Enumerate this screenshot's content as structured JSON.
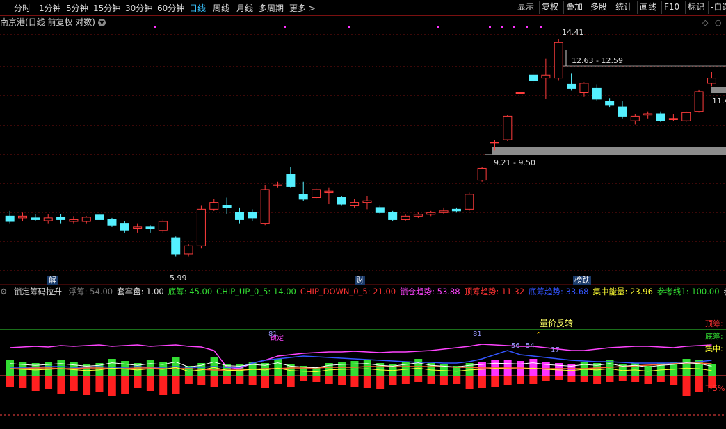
{
  "toolbar": {
    "periods": [
      "分时",
      "1分钟",
      "5分钟",
      "15分钟",
      "30分钟",
      "60分钟",
      "日线",
      "周线",
      "月线",
      "多周期",
      "更多 >"
    ],
    "active_period": "日线",
    "right_buttons": [
      "显示",
      "复权",
      "叠加",
      "多股",
      "统计",
      "画线",
      "F10",
      "标记",
      "-自选"
    ]
  },
  "title": "南京港(日线 前复权 对数)",
  "price_labels": {
    "high": "14.41",
    "low": "5.99",
    "zone_upper": "12.63 - 12.59",
    "zone_lower": "9.21 - 9.50",
    "right_edge": "11.4"
  },
  "event_tags": [
    "解",
    "财",
    "榜跌"
  ],
  "indicator": {
    "name": "锁定筹码拉升",
    "items": [
      {
        "label": "浮筹: 54.00",
        "color": "#7a7a7a"
      },
      {
        "label": "套牢盘: 1.00",
        "color": "#e0e0e0"
      },
      {
        "label": "底筹: 45.00",
        "color": "#33dd33"
      },
      {
        "label": "CHIP_UP_0_5: 14.00",
        "color": "#33dd33"
      },
      {
        "label": "CHIP_DOWN_0_5: 21.00",
        "color": "#ff3333"
      },
      {
        "label": "锁仓趋势: 53.88",
        "color": "#ff44ff"
      },
      {
        "label": "顶筹趋势: 11.32",
        "color": "#ff3333"
      },
      {
        "label": "底筹趋势: 33.68",
        "color": "#3355ff"
      },
      {
        "label": "集中能量: 23.96",
        "color": "#ffff33"
      },
      {
        "label": "参考线1: 100.00",
        "color": "#33dd33"
      },
      {
        "label": "参考线",
        "color": "#e0e0e0"
      }
    ],
    "signal_label": "量价反转",
    "lock_label": "锁定",
    "markers": [
      "81",
      "81",
      "56",
      "54",
      "17"
    ],
    "right_labels": [
      {
        "text": "顶筹:",
        "color": "#ff3333"
      },
      {
        "text": "底筹:",
        "color": "#33dd33"
      },
      {
        "text": "集中:",
        "color": "#ffff33"
      },
      {
        "text": "下5%",
        "color": "#ff3333"
      }
    ]
  },
  "colors": {
    "up": "#ff3c3c",
    "down": "#54f0ff",
    "grid": "#7a1010",
    "zone": "#8c8c8c"
  },
  "chart_data": {
    "type": "candlestick",
    "scale": "log",
    "ylim": [
      5.5,
      15.5
    ],
    "candles": [
      {
        "o": 7.05,
        "h": 7.2,
        "l": 6.85,
        "c": 6.9
      },
      {
        "o": 7.0,
        "h": 7.15,
        "l": 6.9,
        "c": 7.05
      },
      {
        "o": 7.0,
        "h": 7.1,
        "l": 6.9,
        "c": 6.95
      },
      {
        "o": 6.92,
        "h": 7.1,
        "l": 6.85,
        "c": 7.0
      },
      {
        "o": 7.02,
        "h": 7.1,
        "l": 6.85,
        "c": 6.95
      },
      {
        "o": 6.9,
        "h": 7.05,
        "l": 6.85,
        "c": 6.95
      },
      {
        "o": 6.9,
        "h": 7.05,
        "l": 6.85,
        "c": 7.02
      },
      {
        "o": 7.08,
        "h": 7.12,
        "l": 6.95,
        "c": 6.95
      },
      {
        "o": 6.95,
        "h": 7.0,
        "l": 6.75,
        "c": 6.8
      },
      {
        "o": 6.85,
        "h": 6.9,
        "l": 6.6,
        "c": 6.65
      },
      {
        "o": 6.7,
        "h": 6.85,
        "l": 6.6,
        "c": 6.75
      },
      {
        "o": 6.75,
        "h": 6.8,
        "l": 6.6,
        "c": 6.7
      },
      {
        "o": 6.65,
        "h": 6.95,
        "l": 6.6,
        "c": 6.9
      },
      {
        "o": 6.45,
        "h": 6.5,
        "l": 5.99,
        "c": 6.05
      },
      {
        "o": 6.05,
        "h": 6.3,
        "l": 5.99,
        "c": 6.25
      },
      {
        "o": 6.25,
        "h": 7.35,
        "l": 6.2,
        "c": 7.25
      },
      {
        "o": 7.25,
        "h": 7.55,
        "l": 7.2,
        "c": 7.45
      },
      {
        "o": 7.35,
        "h": 7.6,
        "l": 7.1,
        "c": 7.3
      },
      {
        "o": 7.15,
        "h": 7.3,
        "l": 6.85,
        "c": 6.95
      },
      {
        "o": 7.15,
        "h": 7.25,
        "l": 6.9,
        "c": 7.0
      },
      {
        "o": 6.85,
        "h": 8.0,
        "l": 6.8,
        "c": 7.85
      },
      {
        "o": 8.0,
        "h": 8.1,
        "l": 7.9,
        "c": 8.0
      },
      {
        "o": 8.35,
        "h": 8.6,
        "l": 7.9,
        "c": 7.95
      },
      {
        "o": 7.7,
        "h": 8.1,
        "l": 7.5,
        "c": 7.55
      },
      {
        "o": 7.6,
        "h": 7.9,
        "l": 7.55,
        "c": 7.85
      },
      {
        "o": 7.75,
        "h": 7.9,
        "l": 7.4,
        "c": 7.8
      },
      {
        "o": 7.6,
        "h": 7.65,
        "l": 7.35,
        "c": 7.4
      },
      {
        "o": 7.35,
        "h": 7.55,
        "l": 7.3,
        "c": 7.45
      },
      {
        "o": 7.45,
        "h": 7.65,
        "l": 7.25,
        "c": 7.5
      },
      {
        "o": 7.3,
        "h": 7.35,
        "l": 7.1,
        "c": 7.15
      },
      {
        "o": 7.15,
        "h": 7.2,
        "l": 6.9,
        "c": 6.95
      },
      {
        "o": 6.95,
        "h": 7.1,
        "l": 6.9,
        "c": 7.05
      },
      {
        "o": 7.05,
        "h": 7.15,
        "l": 7.0,
        "c": 7.1
      },
      {
        "o": 7.1,
        "h": 7.2,
        "l": 7.05,
        "c": 7.15
      },
      {
        "o": 7.15,
        "h": 7.3,
        "l": 7.1,
        "c": 7.2
      },
      {
        "o": 7.25,
        "h": 7.3,
        "l": 7.15,
        "c": 7.2
      },
      {
        "o": 7.25,
        "h": 7.75,
        "l": 7.2,
        "c": 7.7
      },
      {
        "o": 8.15,
        "h": 8.6,
        "l": 8.1,
        "c": 8.55
      },
      {
        "o": 9.5,
        "h": 9.6,
        "l": 9.2,
        "c": 9.5
      },
      {
        "o": 9.6,
        "h": 10.6,
        "l": 9.55,
        "c": 10.55
      },
      {
        "o": 11.6,
        "h": 11.6,
        "l": 11.6,
        "c": 11.6
      },
      {
        "o": 12.45,
        "h": 12.8,
        "l": 12.0,
        "c": 12.2
      },
      {
        "o": 12.3,
        "h": 13.3,
        "l": 11.3,
        "c": 12.45
      },
      {
        "o": 12.3,
        "h": 14.41,
        "l": 12.2,
        "c": 14.2
      },
      {
        "o": 12.0,
        "h": 12.55,
        "l": 11.7,
        "c": 11.8
      },
      {
        "o": 11.6,
        "h": 12.1,
        "l": 11.4,
        "c": 12.05
      },
      {
        "o": 11.8,
        "h": 12.0,
        "l": 11.2,
        "c": 11.3
      },
      {
        "o": 11.2,
        "h": 11.35,
        "l": 10.95,
        "c": 11.05
      },
      {
        "o": 10.95,
        "h": 11.2,
        "l": 10.45,
        "c": 10.55
      },
      {
        "o": 10.35,
        "h": 10.65,
        "l": 10.2,
        "c": 10.55
      },
      {
        "o": 10.6,
        "h": 10.75,
        "l": 10.45,
        "c": 10.65
      },
      {
        "o": 10.65,
        "h": 10.75,
        "l": 10.3,
        "c": 10.35
      },
      {
        "o": 10.4,
        "h": 10.65,
        "l": 10.35,
        "c": 10.45
      },
      {
        "o": 10.35,
        "h": 10.75,
        "l": 10.3,
        "c": 10.7
      },
      {
        "o": 10.75,
        "h": 11.75,
        "l": 10.7,
        "c": 11.65
      },
      {
        "o": 12.05,
        "h": 12.6,
        "l": 11.9,
        "c": 12.3
      }
    ],
    "bars": [
      22,
      20,
      18,
      20,
      22,
      19,
      16,
      18,
      24,
      21,
      18,
      22,
      20,
      26,
      14,
      18,
      26,
      17,
      16,
      20,
      18,
      24,
      16,
      14,
      12,
      18,
      20,
      21,
      22,
      18,
      16,
      20,
      24,
      18,
      16,
      14,
      18,
      20,
      23,
      22,
      21,
      24,
      20,
      18,
      16,
      20,
      18,
      22,
      16,
      18,
      14,
      18,
      20,
      24,
      22,
      16
    ],
    "bar_colors": [
      "g",
      "g",
      "g",
      "g",
      "g",
      "g",
      "g",
      "g",
      "g",
      "g",
      "g",
      "g",
      "g",
      "g",
      "g",
      "g",
      "g",
      "g",
      "g",
      "g",
      "g",
      "g",
      "g",
      "g",
      "g",
      "g",
      "g",
      "g",
      "g",
      "g",
      "g",
      "g",
      "g",
      "g",
      "g",
      "g",
      "g",
      "m",
      "m",
      "m",
      "m",
      "m",
      "m",
      "m",
      "m",
      "g",
      "g",
      "g",
      "g",
      "g",
      "g",
      "g",
      "g",
      "g",
      "g",
      "g"
    ],
    "neg_bars": [
      16,
      18,
      22,
      20,
      26,
      22,
      28,
      24,
      30,
      26,
      18,
      22,
      28,
      26,
      12,
      14,
      16,
      12,
      12,
      14,
      18,
      12,
      16,
      8,
      10,
      12,
      14,
      16,
      18,
      20,
      14,
      12,
      10,
      12,
      14,
      12,
      20,
      18,
      16,
      14,
      12,
      12,
      8,
      6,
      10,
      10,
      12,
      10,
      8,
      10,
      12,
      10,
      14,
      30,
      24,
      18
    ],
    "series": [
      {
        "name": "锁仓趋势",
        "values": [
          40,
          41,
          42,
          41,
          43,
          42,
          43,
          44,
          42,
          43,
          44,
          42,
          43,
          44,
          42,
          41,
          36,
          12,
          10,
          18,
          22,
          28,
          30,
          32,
          33,
          34,
          34,
          35,
          34,
          33,
          34,
          34,
          35,
          36,
          38,
          40,
          42,
          45,
          44,
          43,
          42,
          42,
          40,
          38,
          36,
          36,
          38,
          40,
          41,
          42,
          42,
          41,
          40,
          42,
          43,
          44
        ]
      },
      {
        "name": "底筹趋势",
        "values": [
          12,
          12,
          12,
          13,
          13,
          12,
          12,
          13,
          12,
          12,
          13,
          12,
          12,
          13,
          12,
          12,
          13,
          12,
          12,
          18,
          22,
          24,
          26,
          28,
          27,
          26,
          25,
          24,
          23,
          22,
          21,
          20,
          19,
          19,
          18,
          18,
          20,
          24,
          30,
          36,
          30,
          28,
          26,
          24,
          22,
          21,
          20,
          20,
          19,
          18,
          18,
          18,
          18,
          18,
          20,
          22
        ]
      },
      {
        "name": "顶筹趋势",
        "values": [
          10,
          10,
          11,
          11,
          10,
          10,
          11,
          11,
          10,
          10,
          11,
          11,
          10,
          10,
          10,
          9,
          8,
          8,
          8,
          9,
          10,
          10,
          11,
          11,
          11,
          12,
          12,
          12,
          13,
          13,
          13,
          13,
          13,
          13,
          13,
          12,
          12,
          11,
          11,
          11,
          11,
          10,
          10,
          10,
          10,
          10,
          11,
          12,
          13,
          14,
          15,
          16,
          17,
          18,
          18,
          17
        ]
      }
    ],
    "ref_line": 100
  }
}
